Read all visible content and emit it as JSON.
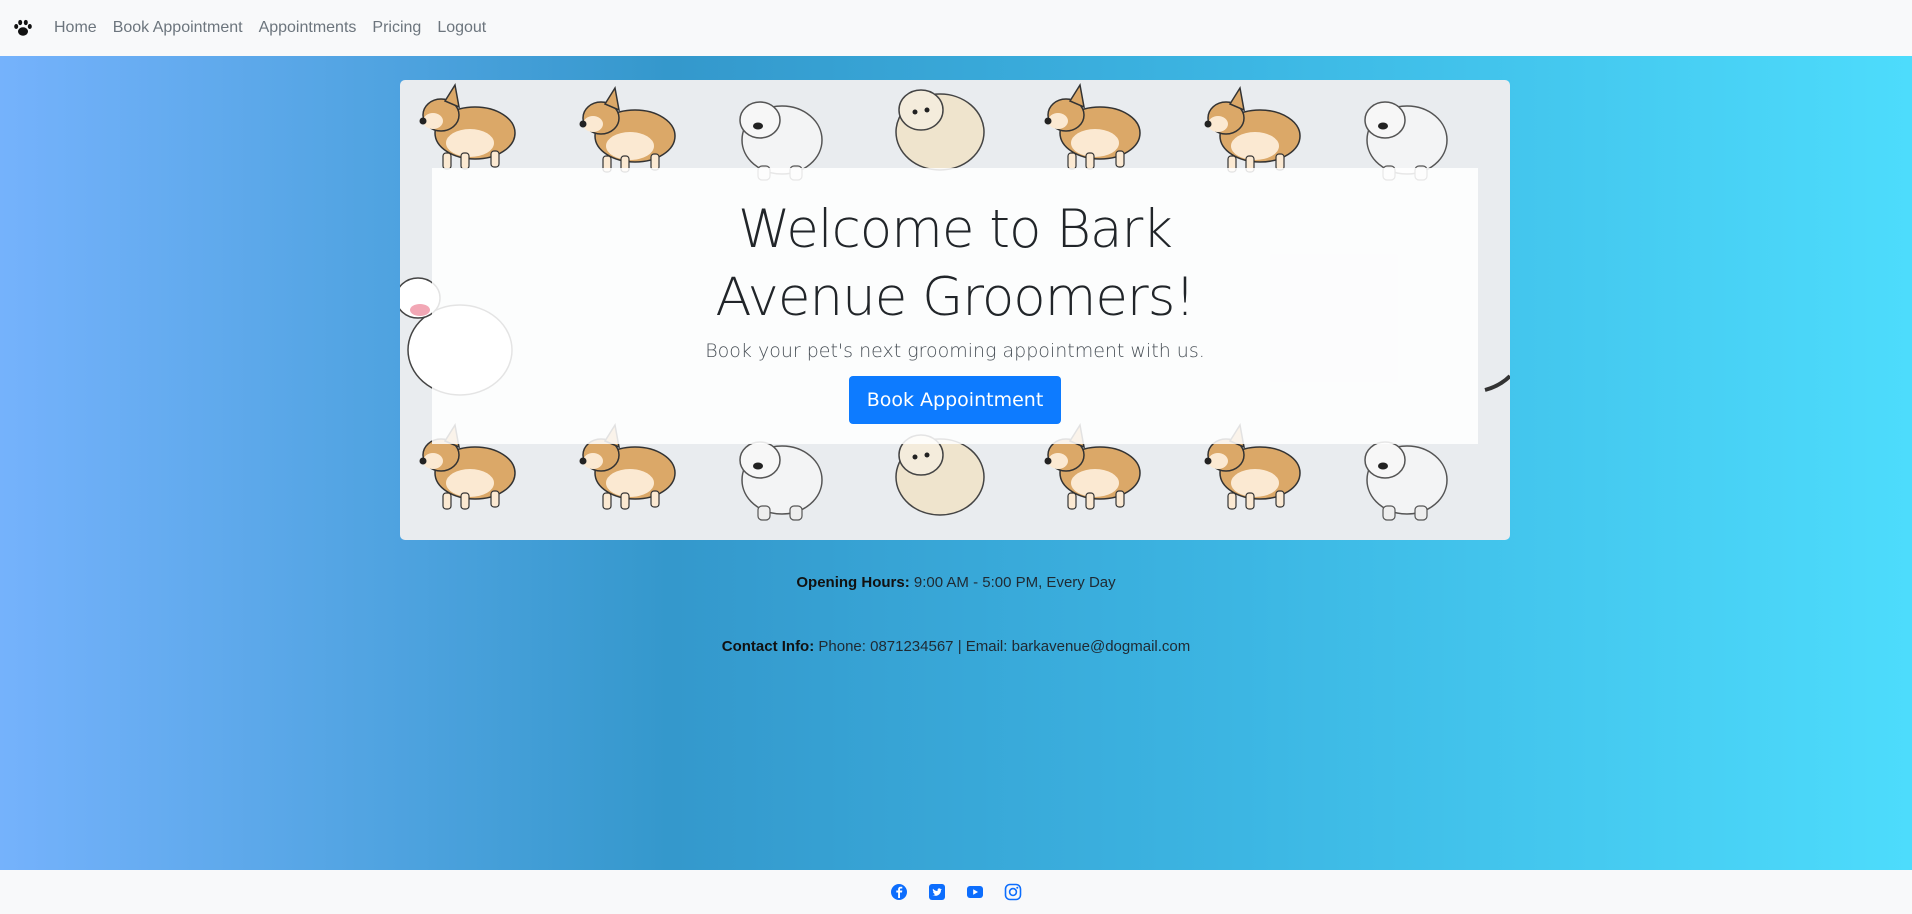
{
  "nav": {
    "brand_icon": "paw-icon",
    "links": [
      "Home",
      "Book Appointment",
      "Appointments",
      "Pricing",
      "Logout"
    ]
  },
  "hero": {
    "title": "Welcome to Bark Avenue Groomers!",
    "subtitle": "Book your pet's next grooming appointment with us.",
    "button_label": "Book Appointment",
    "button_color": "#0d7bff"
  },
  "info": {
    "hours_label": "Opening Hours:",
    "hours_value": "9:00 AM - 5:00 PM, Every Day",
    "contact_label": "Contact Info:",
    "contact_value": "Phone: 0871234567 | Email: barkavenue@dogmail.com"
  },
  "footer": {
    "social_icons": [
      "facebook-icon",
      "twitter-icon",
      "youtube-icon",
      "instagram-icon"
    ],
    "icon_color": "#0d6efd"
  }
}
